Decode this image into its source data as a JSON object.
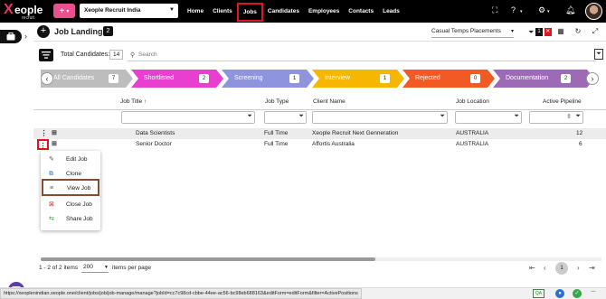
{
  "app": {
    "logo_text": "Xeople",
    "logo_sub": "recruit",
    "company": "Xeople Recruit India",
    "nav": [
      {
        "label": "Home",
        "active": false
      },
      {
        "label": "Clients",
        "active": false
      },
      {
        "label": "Jobs",
        "active": true
      },
      {
        "label": "Candidates",
        "active": false
      },
      {
        "label": "Employees",
        "active": false
      },
      {
        "label": "Contacts",
        "active": false
      },
      {
        "label": "Leads",
        "active": false
      }
    ],
    "plus_label": "+",
    "colors": {
      "accent": "#e8518c",
      "active_outline": "#e0161f"
    }
  },
  "header": {
    "title": "Job Landing",
    "count": "2",
    "view_select": "Casual Temps Placements",
    "filter_count": "1"
  },
  "toolbar": {
    "total_label": "Total Candidates:",
    "total_value": "14",
    "search_placeholder": "Search"
  },
  "pipeline": [
    {
      "label": "All Candidates",
      "count": "7",
      "color": "#bdbdbd"
    },
    {
      "label": "Shortlisted",
      "count": "2",
      "color": "#e83fd1"
    },
    {
      "label": "Screening",
      "count": "1",
      "color": "#8e95dc"
    },
    {
      "label": "Interview",
      "count": "1",
      "color": "#f7b600"
    },
    {
      "label": "Rejected",
      "count": "0",
      "color": "#f15a22"
    },
    {
      "label": "Documentation",
      "count": "2",
      "color": "#9d6bb5"
    }
  ],
  "grid": {
    "columns": [
      "Job Title",
      "Job Type",
      "Client Name",
      "Job Location",
      "Active Pipeline"
    ],
    "rows": [
      {
        "title": "Data Scientists",
        "type": "Full Time",
        "client": "Xeople Recruit Next Genneration",
        "location": "AUSTRALIA",
        "pipeline": "12"
      },
      {
        "title": "Senior Doctor",
        "type": "Full Time",
        "client": "Affortis Australia",
        "location": "AUSTRALIA",
        "pipeline": "6"
      }
    ]
  },
  "context_menu": [
    {
      "label": "Edit Job",
      "icon": "pencil-icon"
    },
    {
      "label": "Clone",
      "icon": "clone-icon"
    },
    {
      "label": "View Job",
      "icon": "list-icon"
    },
    {
      "label": "Close Job",
      "icon": "close-job-icon"
    },
    {
      "label": "Share Job",
      "icon": "share-icon"
    }
  ],
  "pager": {
    "summary": "1 - 2 of 2 items",
    "page_size": "200",
    "page_size_label": "items per page",
    "current_page": "1"
  },
  "status": {
    "url": "https://xeoplenindian.xeople.one/client/jobs/job/job-manage/manage?jobId=cc7c98cd-cbbe-44ee-ac56-bc98eb688163&editForm=editForm&filter=ActivePositions",
    "qa_label": "QA"
  }
}
